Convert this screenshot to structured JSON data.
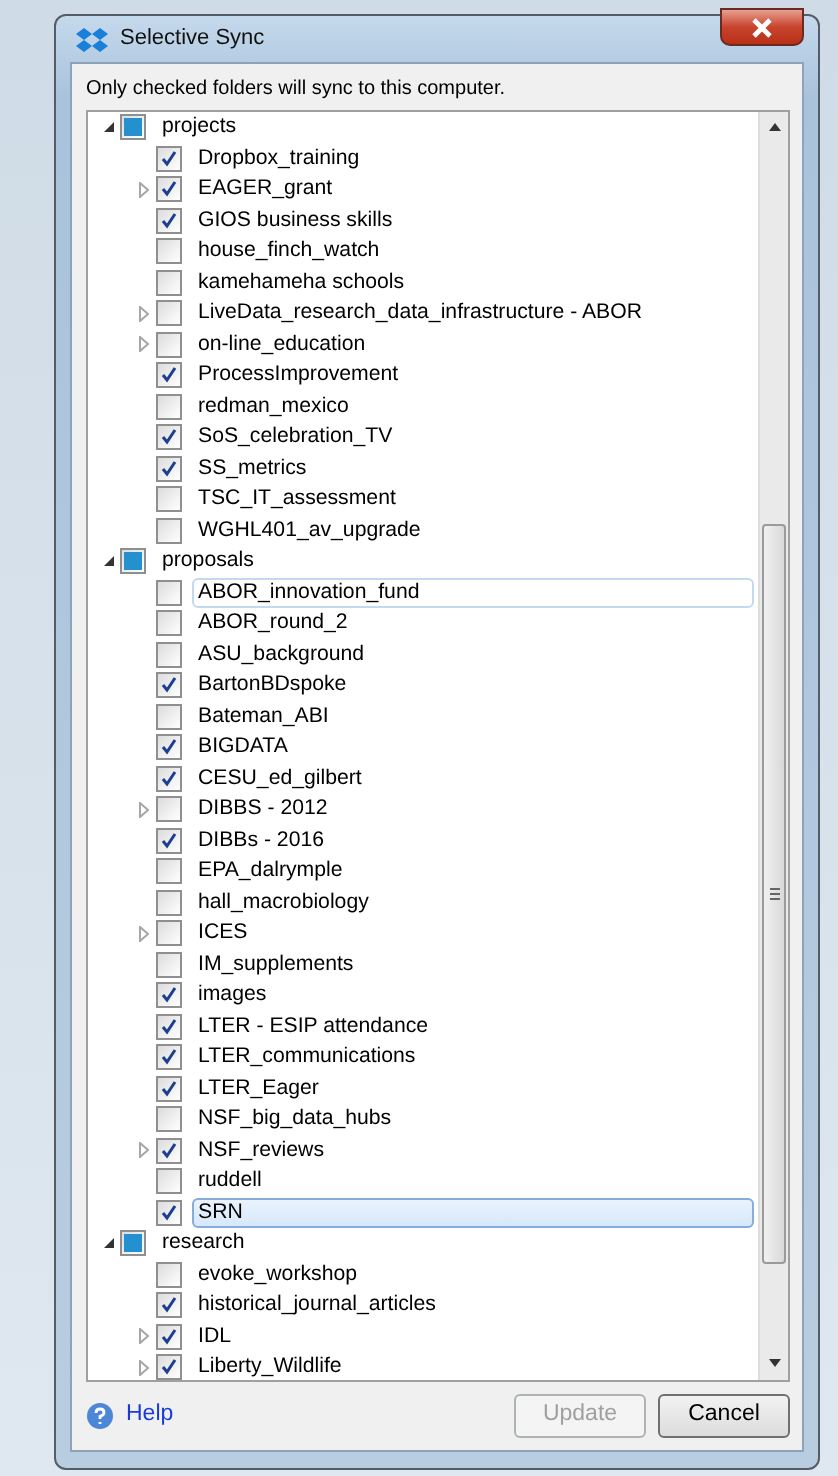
{
  "window": {
    "title": "Selective Sync"
  },
  "instruction": "Only checked folders will sync to this computer.",
  "tree": [
    {
      "label": "projects",
      "partial": true,
      "expanded": true,
      "selected": false,
      "focused": false,
      "children": [
        {
          "label": "Dropbox_training",
          "checked": true,
          "expandable": false,
          "selected": false,
          "focused": false
        },
        {
          "label": "EAGER_grant",
          "checked": true,
          "expandable": true,
          "selected": false,
          "focused": false
        },
        {
          "label": "GIOS business skills",
          "checked": true,
          "expandable": false,
          "selected": false,
          "focused": false
        },
        {
          "label": "house_finch_watch",
          "checked": false,
          "expandable": false,
          "selected": false,
          "focused": false
        },
        {
          "label": "kamehameha schools",
          "checked": false,
          "expandable": false,
          "selected": false,
          "focused": false
        },
        {
          "label": "LiveData_research_data_infrastructure - ABOR",
          "checked": false,
          "expandable": true,
          "selected": false,
          "focused": false
        },
        {
          "label": "on-line_education",
          "checked": false,
          "expandable": true,
          "selected": false,
          "focused": false
        },
        {
          "label": "ProcessImprovement",
          "checked": true,
          "expandable": false,
          "selected": false,
          "focused": false
        },
        {
          "label": "redman_mexico",
          "checked": false,
          "expandable": false,
          "selected": false,
          "focused": false
        },
        {
          "label": "SoS_celebration_TV",
          "checked": true,
          "expandable": false,
          "selected": false,
          "focused": false
        },
        {
          "label": "SS_metrics",
          "checked": true,
          "expandable": false,
          "selected": false,
          "focused": false
        },
        {
          "label": "TSC_IT_assessment",
          "checked": false,
          "expandable": false,
          "selected": false,
          "focused": false
        },
        {
          "label": "WGHL401_av_upgrade",
          "checked": false,
          "expandable": false,
          "selected": false,
          "focused": false
        }
      ]
    },
    {
      "label": "proposals",
      "partial": true,
      "expanded": true,
      "selected": false,
      "focused": false,
      "children": [
        {
          "label": "ABOR_innovation_fund",
          "checked": false,
          "expandable": false,
          "selected": false,
          "focused": true
        },
        {
          "label": "ABOR_round_2",
          "checked": false,
          "expandable": false,
          "selected": false,
          "focused": false
        },
        {
          "label": "ASU_background",
          "checked": false,
          "expandable": false,
          "selected": false,
          "focused": false
        },
        {
          "label": "BartonBDspoke",
          "checked": true,
          "expandable": false,
          "selected": false,
          "focused": false
        },
        {
          "label": "Bateman_ABI",
          "checked": false,
          "expandable": false,
          "selected": false,
          "focused": false
        },
        {
          "label": "BIGDATA",
          "checked": true,
          "expandable": false,
          "selected": false,
          "focused": false
        },
        {
          "label": "CESU_ed_gilbert",
          "checked": true,
          "expandable": false,
          "selected": false,
          "focused": false
        },
        {
          "label": "DIBBS - 2012",
          "checked": false,
          "expandable": true,
          "selected": false,
          "focused": false
        },
        {
          "label": "DIBBs - 2016",
          "checked": true,
          "expandable": false,
          "selected": false,
          "focused": false
        },
        {
          "label": "EPA_dalrymple",
          "checked": false,
          "expandable": false,
          "selected": false,
          "focused": false
        },
        {
          "label": "hall_macrobiology",
          "checked": false,
          "expandable": false,
          "selected": false,
          "focused": false
        },
        {
          "label": "ICES",
          "checked": false,
          "expandable": true,
          "selected": false,
          "focused": false
        },
        {
          "label": "IM_supplements",
          "checked": false,
          "expandable": false,
          "selected": false,
          "focused": false
        },
        {
          "label": "images",
          "checked": true,
          "expandable": false,
          "selected": false,
          "focused": false
        },
        {
          "label": "LTER - ESIP attendance",
          "checked": true,
          "expandable": false,
          "selected": false,
          "focused": false
        },
        {
          "label": "LTER_communications",
          "checked": true,
          "expandable": false,
          "selected": false,
          "focused": false
        },
        {
          "label": "LTER_Eager",
          "checked": true,
          "expandable": false,
          "selected": false,
          "focused": false
        },
        {
          "label": "NSF_big_data_hubs",
          "checked": false,
          "expandable": false,
          "selected": false,
          "focused": false
        },
        {
          "label": "NSF_reviews",
          "checked": true,
          "expandable": true,
          "selected": false,
          "focused": false
        },
        {
          "label": "ruddell",
          "checked": false,
          "expandable": false,
          "selected": false,
          "focused": false
        },
        {
          "label": "SRN",
          "checked": true,
          "expandable": false,
          "selected": true,
          "focused": false
        }
      ]
    },
    {
      "label": "research",
      "partial": true,
      "expanded": true,
      "selected": false,
      "focused": false,
      "children": [
        {
          "label": "evoke_workshop",
          "checked": false,
          "expandable": false,
          "selected": false,
          "focused": false
        },
        {
          "label": "historical_journal_articles",
          "checked": true,
          "expandable": false,
          "selected": false,
          "focused": false
        },
        {
          "label": "IDL",
          "checked": true,
          "expandable": true,
          "selected": false,
          "focused": false
        },
        {
          "label": "Liberty_Wildlife",
          "checked": true,
          "expandable": true,
          "selected": false,
          "focused": false
        }
      ]
    }
  ],
  "help_link": "Help",
  "buttons": [
    {
      "label": "Update",
      "disabled": true
    },
    {
      "label": "Cancel",
      "disabled": false
    }
  ]
}
